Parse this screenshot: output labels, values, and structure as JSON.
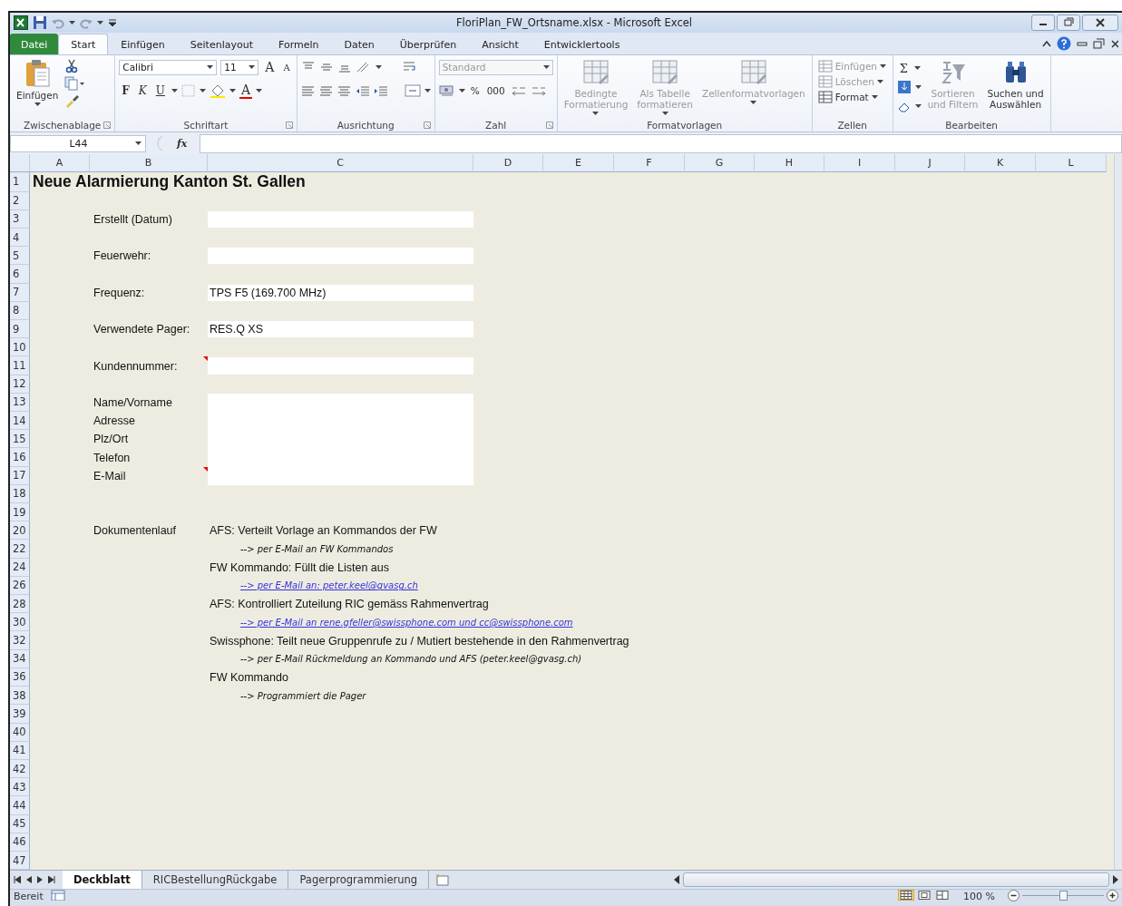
{
  "window": {
    "title": "FloriPlan_FW_Ortsname.xlsx  -  Microsoft Excel"
  },
  "tabs": [
    {
      "label": "Datei",
      "kind": "file",
      "selected": false
    },
    {
      "label": "Start",
      "kind": "tab",
      "selected": true
    },
    {
      "label": "Einfügen",
      "kind": "tab",
      "selected": false
    },
    {
      "label": "Seitenlayout",
      "kind": "tab",
      "selected": false
    },
    {
      "label": "Formeln",
      "kind": "tab",
      "selected": false
    },
    {
      "label": "Daten",
      "kind": "tab",
      "selected": false
    },
    {
      "label": "Überprüfen",
      "kind": "tab",
      "selected": false
    },
    {
      "label": "Ansicht",
      "kind": "tab",
      "selected": false
    },
    {
      "label": "Entwicklertools",
      "kind": "tab",
      "selected": false
    }
  ],
  "ribbon": {
    "groups": [
      {
        "kind": "clipboard",
        "label": "Zwischenablage",
        "paste": "Einfügen"
      },
      {
        "kind": "font",
        "label": "Schriftart",
        "font": "Calibri",
        "size": "11",
        "grow": "A",
        "shrink": "A",
        "bold": "F",
        "italic": "K",
        "underline": "U",
        "font_color_button": "A"
      },
      {
        "kind": "alignment",
        "label": "Ausrichtung"
      },
      {
        "kind": "number",
        "label": "Zahl",
        "format": "Standard",
        "format_disabled": true,
        "percent": "%",
        "thousands": "000"
      },
      {
        "kind": "styles",
        "label": "Formatvorlagen",
        "buttons": [
          {
            "lines": [
              "Bedingte",
              "Formatierung"
            ],
            "disabled": true
          },
          {
            "lines": [
              "Als Tabelle",
              "formatieren"
            ],
            "disabled": true
          },
          {
            "lines": [
              "Zellenformatvorlagen"
            ],
            "disabled": true
          }
        ]
      },
      {
        "kind": "cells",
        "label": "Zellen",
        "buttons": [
          {
            "label": "Einfügen",
            "disabled": true
          },
          {
            "label": "Löschen",
            "disabled": true
          },
          {
            "label": "Format",
            "disabled": false
          }
        ]
      },
      {
        "kind": "editing",
        "label": "Bearbeiten",
        "sum": "Σ",
        "buttons": [
          {
            "lines": [
              "Sortieren",
              "und Filtern"
            ],
            "disabled": true
          },
          {
            "lines": [
              "Suchen und",
              "Auswählen"
            ],
            "disabled": false
          }
        ]
      }
    ]
  },
  "formula_bar": {
    "name_box": "L44",
    "function_label": "fx"
  },
  "columns": [
    "A",
    "B",
    "C",
    "D",
    "E",
    "F",
    "G",
    "H",
    "I",
    "J",
    "K",
    "L"
  ],
  "rows": [
    {
      "number": "1",
      "kind": "title",
      "text": "Neue Alarmierung Kanton St. Gallen"
    },
    {
      "number": "2",
      "kind": "empty"
    },
    {
      "number": "3",
      "kind": "field",
      "label": "Erstellt (Datum)",
      "comment": false
    },
    {
      "number": "4",
      "kind": "empty"
    },
    {
      "number": "5",
      "kind": "field",
      "label": "Feuerwehr:",
      "comment": false
    },
    {
      "number": "6",
      "kind": "empty"
    },
    {
      "number": "7",
      "kind": "field",
      "label": "Frequenz:",
      "value": "TPS F5 (169.700 MHz)",
      "comment": false
    },
    {
      "number": "8",
      "kind": "empty"
    },
    {
      "number": "9",
      "kind": "field",
      "label": "Verwendete Pager:",
      "value": "RES.Q XS",
      "comment": false
    },
    {
      "number": "10",
      "kind": "empty"
    },
    {
      "number": "11",
      "kind": "field",
      "label": "Kundennummer:",
      "comment": true
    },
    {
      "number": "12",
      "kind": "empty"
    },
    {
      "number": "13",
      "kind": "block",
      "label": "Name/Vorname",
      "comment": false
    },
    {
      "number": "14",
      "kind": "block",
      "label": "Adresse",
      "comment": false
    },
    {
      "number": "15",
      "kind": "block",
      "label": "Plz/Ort",
      "comment": false
    },
    {
      "number": "16",
      "kind": "block",
      "label": "Telefon",
      "comment": false
    },
    {
      "number": "17",
      "kind": "block",
      "label": "E-Mail",
      "comment": true
    },
    {
      "number": "18",
      "kind": "empty"
    },
    {
      "number": "19",
      "kind": "empty"
    },
    {
      "number": "20",
      "kind": "text",
      "label": "Dokumentenlauf",
      "text": "AFS: Verteilt Vorlage an Kommandos der FW"
    },
    {
      "number": "22",
      "kind": "note",
      "text": "--> per E-Mail an FW Kommandos",
      "link": false
    },
    {
      "number": "24",
      "kind": "text",
      "text": "FW Kommando: Füllt die Listen aus"
    },
    {
      "number": "26",
      "kind": "note",
      "text": "--> per E-Mail an: peter.keel@gvasg.ch",
      "link": true
    },
    {
      "number": "28",
      "kind": "text",
      "text": "AFS: Kontrolliert Zuteilung RIC gemäss Rahmenvertrag"
    },
    {
      "number": "30",
      "kind": "note",
      "text": "--> per E-Mail an rene.gfeller@swissphone.com und cc@swissphone.com",
      "link": true
    },
    {
      "number": "32",
      "kind": "text",
      "text": "Swissphone: Teilt neue Gruppenrufe zu / Mutiert bestehende in den Rahmenvertrag"
    },
    {
      "number": "34",
      "kind": "note",
      "text": "--> per E-Mail Rückmeldung an Kommando und AFS (peter.keel@gvasg.ch)",
      "link": false
    },
    {
      "number": "36",
      "kind": "text",
      "text": "FW Kommando"
    },
    {
      "number": "38",
      "kind": "note",
      "text": "--> Programmiert die Pager",
      "link": false
    },
    {
      "number": "39",
      "kind": "empty"
    },
    {
      "number": "40",
      "kind": "empty"
    },
    {
      "number": "41",
      "kind": "empty"
    },
    {
      "number": "42",
      "kind": "empty"
    },
    {
      "number": "43",
      "kind": "empty"
    },
    {
      "number": "44",
      "kind": "empty"
    },
    {
      "number": "45",
      "kind": "empty"
    },
    {
      "number": "46",
      "kind": "empty"
    },
    {
      "number": "47",
      "kind": "empty"
    }
  ],
  "sheet_tabs": [
    {
      "label": "Deckblatt",
      "selected": true
    },
    {
      "label": "RICBestellungRückgabe",
      "selected": false
    },
    {
      "label": "Pagerprogrammierung",
      "selected": false
    }
  ],
  "status_bar": {
    "status": "Bereit",
    "views": [
      {
        "kind": "normal",
        "selected": true
      },
      {
        "kind": "layout",
        "selected": false
      },
      {
        "kind": "pagebreak",
        "selected": false
      }
    ],
    "zoom": "100 %",
    "zoom_slider": {
      "level": 0.5
    }
  }
}
